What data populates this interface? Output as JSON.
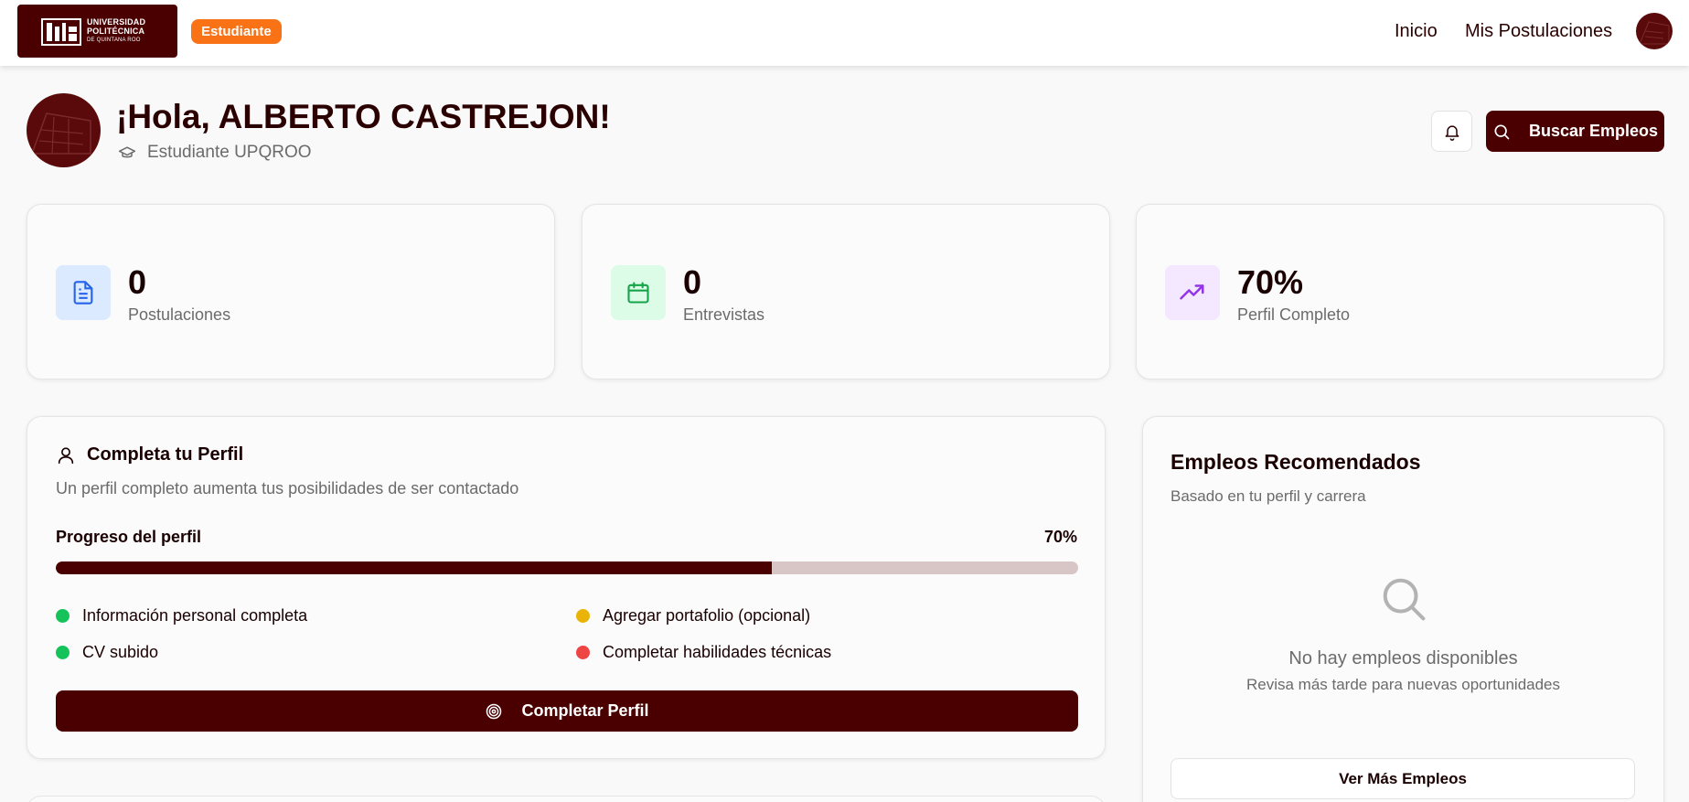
{
  "topbar": {
    "logo": {
      "line1": "UNIVERSIDAD",
      "line2": "POLITÉCNICA",
      "line3": "DE QUINTANA ROO"
    },
    "role_badge": "Estudiante",
    "nav": {
      "home": "Inicio",
      "applications": "Mis Postulaciones"
    }
  },
  "header": {
    "greeting": "¡Hola, ALBERTO CASTREJON!",
    "subtitle": "Estudiante UPQROO",
    "search_button": "Buscar Empleos"
  },
  "stats": [
    {
      "value": "0",
      "label": "Postulaciones",
      "icon": "file-text-icon",
      "bg": "#dbeafe",
      "color": "#2563eb"
    },
    {
      "value": "0",
      "label": "Entrevistas",
      "icon": "calendar-icon",
      "bg": "#dcfce7",
      "color": "#16a34a"
    },
    {
      "value": "70%",
      "label": "Perfil Completo",
      "icon": "trending-up-icon",
      "bg": "#f3e8ff",
      "color": "#9333ea"
    }
  ],
  "profile": {
    "title": "Completa tu Perfil",
    "subtitle": "Un perfil completo aumenta tus posibilidades de ser contactado",
    "progress_label": "Progreso del perfil",
    "progress_value": "70%",
    "progress_fraction": 0.7,
    "checklist": [
      {
        "label": "Información personal completa",
        "status_color": "#16c35a"
      },
      {
        "label": "Agregar portafolio (opcional)",
        "status_color": "#eab308"
      },
      {
        "label": "CV subido",
        "status_color": "#16c35a"
      },
      {
        "label": "Completar habilidades técnicas",
        "status_color": "#ef4444"
      }
    ],
    "complete_button": "Completar Perfil"
  },
  "jobs": {
    "title": "Empleos Recomendados",
    "subtitle": "Basado en tu perfil y carrera",
    "empty_title": "No hay empleos disponibles",
    "empty_subtitle": "Revisa más tarde para nuevas oportunidades",
    "more_button": "Ver Más Empleos"
  },
  "colors": {
    "brand": "#4a0000",
    "accent": "#f97316"
  }
}
